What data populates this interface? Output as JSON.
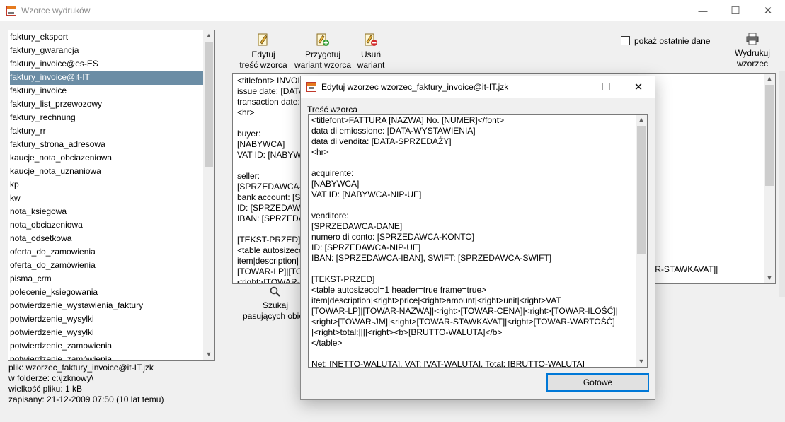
{
  "window": {
    "title": "Wzorce wydruków",
    "minimize_glyph": "—",
    "maximize_glyph": "☐",
    "close_glyph": "✕"
  },
  "template_list": {
    "items": [
      "faktury_eksport",
      "faktury_gwarancja",
      "faktury_invoice@es-ES",
      "faktury_invoice@it-IT",
      "faktury_invoice",
      "faktury_list_przewozowy",
      "faktury_rechnung",
      "faktury_rr",
      "faktury_strona_adresowa",
      "kaucje_nota_obciazeniowa",
      "kaucje_nota_uznaniowa",
      "kp",
      "kw",
      "nota_ksiegowa",
      "nota_obciazeniowa",
      "nota_odsetkowa",
      "oferta_do_zamowienia",
      "oferta_do_zamówienia",
      "pisma_crm",
      "polecenie_ksiegowania",
      "potwierdzenie_wystawienia_faktury",
      "potwierdzenie_wysylki",
      "potwierdzenie_wysyłki",
      "potwierdzenie_zamowienia",
      "potwierdzenie_zamówienia"
    ],
    "selected_index": 3
  },
  "file_info": {
    "file": "plik: wzorzec_faktury_invoice@it-IT.jzk",
    "folder": "w folderze: c:\\jzknowy\\",
    "size": "wielkość pliku: 1 kB",
    "saved": "zapisany: 21-12-2009 07:50 (10 lat temu)"
  },
  "toolbar": {
    "edit_label_1": "Edytuj",
    "edit_label_2": "treść wzorca",
    "prepare_label_1": "Przygotuj",
    "prepare_label_2": "wariant wzorca",
    "remove_label_1": "Usuń",
    "remove_label_2": "wariant",
    "search_label_1": "Szukaj",
    "search_label_2": "pasujących obiek",
    "print_label_1": "Wydrukuj",
    "print_label_2": "wzorzec",
    "show_last_label": "pokaż ostatnie dane",
    "show_last_checked": false
  },
  "preview": {
    "lines": [
      "<titlefont> INVOI",
      "issue date: [DATA",
      "transaction date:",
      "<hr>",
      "",
      "buyer:",
      "[NABYWCA]",
      "VAT ID: [NABYW",
      "",
      "seller:",
      "[SPRZEDAWCA-D",
      "bank account: [S",
      "ID: [SPRZEDAWCA",
      "IBAN: [SPRZEDAW",
      "",
      "[TEKST-PRZED]",
      "<table autosizeco",
      "item|description|",
      "[TOWAR-LP]|[TOW",
      "<right>[TOWAR-"
    ],
    "overflow_fragment": "OWAR-STAWKAVAT]|"
  },
  "dialog": {
    "title": "Edytuj wzorzec wzorzec_faktury_invoice@it-IT.jzk",
    "content_label": "Treść wzorca",
    "lines": [
      "<titlefont>FATTURA [NAZWA] No. [NUMER]</font>",
      "data di emiossione: [DATA-WYSTAWIENIA]",
      "data di vendita: [DATA-SPRZEDAŻY]",
      "<hr>",
      "",
      "acquirente:",
      "[NABYWCA]",
      "VAT ID: [NABYWCA-NIP-UE]",
      "",
      "venditore:",
      "[SPRZEDAWCA-DANE]",
      "numero di conto: [SPRZEDAWCA-KONTO]",
      "ID: [SPRZEDAWCA-NIP-UE]",
      "IBAN: [SPRZEDAWCA-IBAN], SWIFT: [SPRZEDAWCA-SWIFT]",
      "",
      "[TEKST-PRZED]",
      "<table autosizecol=1 header=true frame=true>",
      "item|description|<right>price|<right>amount|<right>unit|<right>VAT",
      "[TOWAR-LP]|[TOWAR-NAZWA]|<right>[TOWAR-CENA]|<right>[TOWAR-ILOŚĆ]|",
      "<right>[TOWAR-JM]|<right>[TOWAR-STAWKAVAT]|<right>[TOWAR-WARTOŚĆ]",
      "|<right>total:||||<right><b>[BRUTTO-WALUTA]</b>",
      "</table>",
      "",
      "Net: [NETTO-WALUTA], VAT: [VAT-WALUTA], Total: [BRUTTO-WALUTA]"
    ],
    "done_label": "Gotowe"
  }
}
